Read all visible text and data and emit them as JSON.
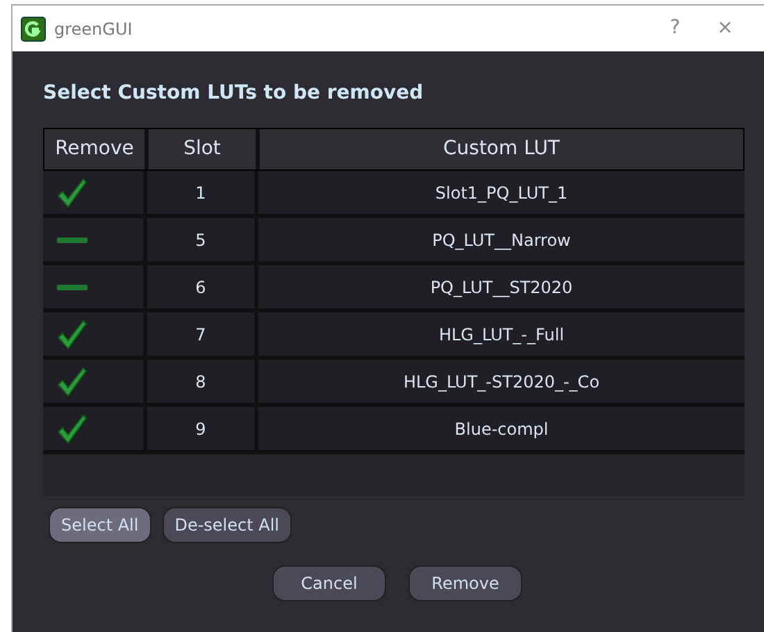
{
  "window": {
    "title": "greenGUI",
    "help": "?",
    "close": "×"
  },
  "heading": "Select Custom LUTs to be removed",
  "table": {
    "columns": [
      "Remove",
      "Slot",
      "Custom LUT"
    ],
    "rows": [
      {
        "checked": true,
        "slot": "1",
        "lut": "Slot1_PQ_LUT_1"
      },
      {
        "checked": false,
        "slot": "5",
        "lut": "PQ_LUT__Narrow"
      },
      {
        "checked": false,
        "slot": "6",
        "lut": "PQ_LUT__ST2020"
      },
      {
        "checked": true,
        "slot": "7",
        "lut": "HLG_LUT_-_Full"
      },
      {
        "checked": true,
        "slot": "8",
        "lut": "HLG_LUT_-ST2020_-_Co"
      },
      {
        "checked": true,
        "slot": "9",
        "lut": "Blue-compl"
      }
    ]
  },
  "selection_buttons": [
    {
      "label": "Select All",
      "focused": true
    },
    {
      "label": "De-select All",
      "focused": false
    }
  ],
  "dialog_buttons": [
    {
      "label": "Cancel",
      "focused": false
    },
    {
      "label": "Remove",
      "focused": false
    }
  ]
}
